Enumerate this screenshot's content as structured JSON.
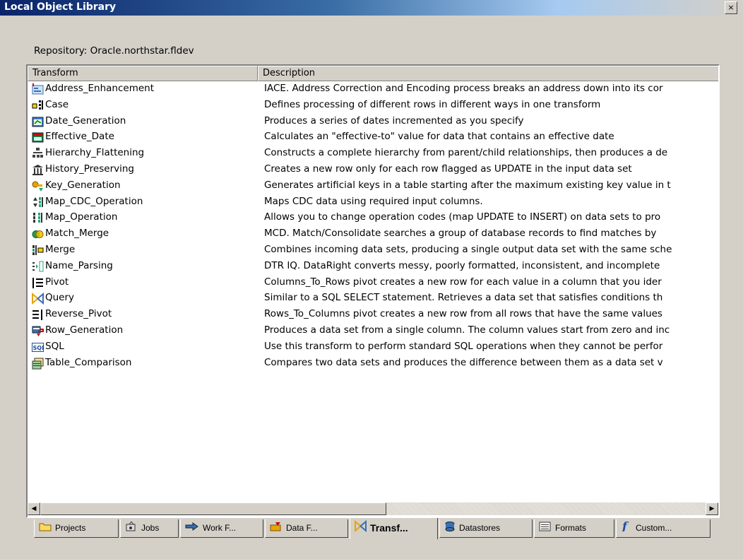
{
  "window": {
    "title": "Local Object Library",
    "close_glyph": "×"
  },
  "repository_label": "Repository: Oracle.northstar.fldev",
  "columns": {
    "transform": "Transform",
    "description": "Description"
  },
  "rows": [
    {
      "icon": "address-enhancement-icon",
      "name": "Address_Enhancement",
      "desc": "IACE. Address Correction and Encoding process breaks an address down into its cor"
    },
    {
      "icon": "case-icon",
      "name": "Case",
      "desc": "Defines processing of different rows in different ways in one transform"
    },
    {
      "icon": "date-generation-icon",
      "name": "Date_Generation",
      "desc": "Produces a series of dates incremented as you specify"
    },
    {
      "icon": "effective-date-icon",
      "name": "Effective_Date",
      "desc": "Calculates an \"effective-to\" value for data that contains an effective date"
    },
    {
      "icon": "hierarchy-flattening-icon",
      "name": "Hierarchy_Flattening",
      "desc": "Constructs a complete hierarchy from parent/child relationships, then produces a de"
    },
    {
      "icon": "history-preserving-icon",
      "name": "History_Preserving",
      "desc": "Creates a new row only for each row flagged as UPDATE in the input data set"
    },
    {
      "icon": "key-generation-icon",
      "name": "Key_Generation",
      "desc": "Generates artificial keys in a table starting after the maximum existing key value in t"
    },
    {
      "icon": "map-cdc-operation-icon",
      "name": "Map_CDC_Operation",
      "desc": "Maps CDC data using required input columns."
    },
    {
      "icon": "map-operation-icon",
      "name": "Map_Operation",
      "desc": "Allows you to change operation codes (map UPDATE to INSERT) on data sets to pro"
    },
    {
      "icon": "match-merge-icon",
      "name": "Match_Merge",
      "desc": "MCD. Match/Consolidate searches a group of database records to find matches by"
    },
    {
      "icon": "merge-icon",
      "name": "Merge",
      "desc": "Combines incoming data sets, producing a single output data set with the same sche"
    },
    {
      "icon": "name-parsing-icon",
      "name": "Name_Parsing",
      "desc": "DTR IQ. DataRight converts messy, poorly formatted, inconsistent, and incomplete"
    },
    {
      "icon": "pivot-icon",
      "name": "Pivot",
      "desc": "Columns_To_Rows pivot creates a new row for each value in a column that you ider"
    },
    {
      "icon": "query-icon",
      "name": "Query",
      "desc": "Similar to a SQL SELECT statement. Retrieves a data set that satisfies conditions th"
    },
    {
      "icon": "reverse-pivot-icon",
      "name": "Reverse_Pivot",
      "desc": "Rows_To_Columns pivot creates a new row from all rows that have the same values"
    },
    {
      "icon": "row-generation-icon",
      "name": "Row_Generation",
      "desc": "Produces a data set from a single column. The column values start from zero and inc"
    },
    {
      "icon": "sql-icon",
      "name": "SQL",
      "desc": "Use this transform to perform standard SQL operations when they cannot be perfor"
    },
    {
      "icon": "table-comparison-icon",
      "name": "Table_Comparison",
      "desc": "Compares two data sets and produces the difference between them as a data set v"
    }
  ],
  "tabs": [
    {
      "icon": "folder-icon",
      "label": "Projects",
      "active": false
    },
    {
      "icon": "jobs-icon",
      "label": "Jobs",
      "active": false
    },
    {
      "icon": "workflow-icon",
      "label": "Work F...",
      "active": false
    },
    {
      "icon": "dataflow-icon",
      "label": "Data F...",
      "active": false
    },
    {
      "icon": "query-icon",
      "label": "Transf...",
      "active": true
    },
    {
      "icon": "datastore-icon",
      "label": "Datastores",
      "active": false
    },
    {
      "icon": "formats-icon",
      "label": "Formats",
      "active": false
    },
    {
      "icon": "function-icon",
      "label": "Custom...",
      "active": false
    }
  ],
  "scrollbar": {
    "left_arrow": "◀",
    "right_arrow": "▶"
  }
}
